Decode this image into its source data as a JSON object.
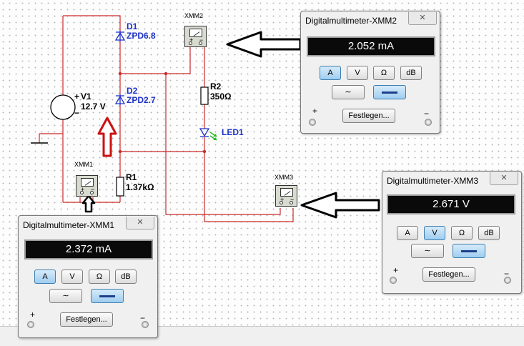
{
  "circuit": {
    "source": {
      "name": "V1",
      "value": "12.7 V",
      "plus": "+",
      "minus": "−"
    },
    "d1": {
      "name": "D1",
      "part": "ZPD6.8"
    },
    "d2": {
      "name": "D2",
      "part": "ZPD2.7"
    },
    "r1": {
      "name": "R1",
      "value": "1.37kΩ"
    },
    "r2": {
      "name": "R2",
      "value": "350Ω"
    },
    "led": {
      "name": "LED1"
    },
    "meters": {
      "xmm1": {
        "name": "XMM1",
        "plus": "+",
        "minus": "−"
      },
      "xmm2": {
        "name": "XMM2",
        "plus": "+",
        "minus": "−"
      },
      "xmm3": {
        "name": "XMM3",
        "plus": "+",
        "minus": "−"
      }
    }
  },
  "windows": {
    "xmm2": {
      "title": "Digitalmultimeter-XMM2",
      "reading": "2.052 mA",
      "active_mode": "A"
    },
    "xmm1": {
      "title": "Digitalmultimeter-XMM1",
      "reading": "2.372 mA",
      "active_mode": "A"
    },
    "xmm3": {
      "title": "Digitalmultimeter-XMM3",
      "reading": "2.671 V",
      "active_mode": "V"
    }
  },
  "controls": {
    "modes": [
      "A",
      "V",
      "Ω",
      "dB"
    ],
    "ac_symbol": "∼",
    "settings_label": "Festlegen...",
    "plus": "+",
    "minus": "−",
    "close_glyph": "✕"
  },
  "colors": {
    "wire": "#cc2a2a",
    "component": "#000000",
    "diode": "#1f33c8",
    "led_rays": "#22bb22",
    "arrow_black": "#000000",
    "arrow_red": "#cc1111",
    "display_bg": "#0a0a0a",
    "display_text": "#ffffff"
  }
}
